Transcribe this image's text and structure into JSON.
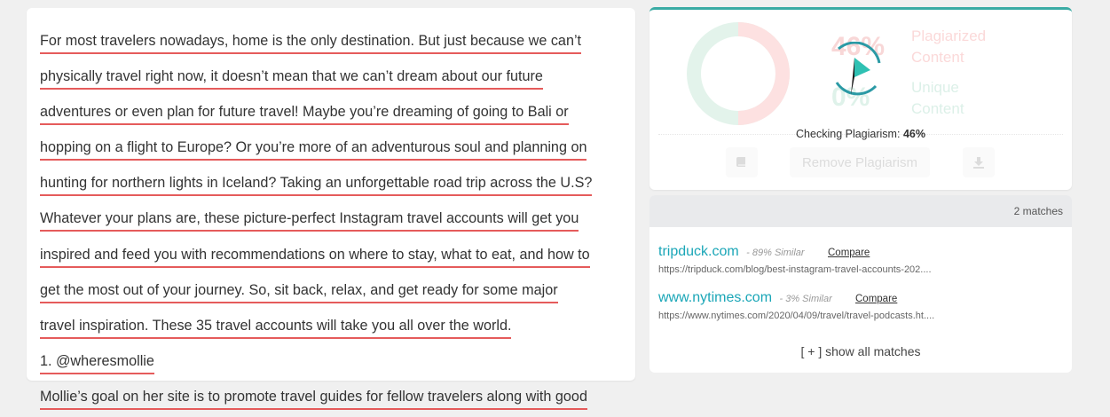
{
  "article": {
    "lines": [
      "For most travelers nowadays, home is the only destination. But just because we can’t",
      "physically travel right now, it doesn’t mean that we can’t dream about our future",
      "adventures or even plan for future travel! Maybe you’re dreaming of going to Bali or",
      "hopping on a flight to Europe? Or you’re more of an adventurous soul and planning on",
      "hunting for northern lights in Iceland? Taking an unforgettable road trip across the U.S?",
      "Whatever your plans are, these picture-perfect Instagram travel accounts will get you",
      "inspired and feed you with recommendations on where to stay, what to eat, and how to",
      "get the most out of your journey.  So, sit back, relax, and get ready for some major",
      "travel inspiration. These 35 travel accounts will take you all over the world.",
      "1. @wheresmollie",
      "Mollie’s goal on her site is to promote travel guides for fellow travelers along with good"
    ]
  },
  "result": {
    "plagiarized_pct": "46%",
    "unique_pct": "0%",
    "plagiarized_label_1": "Plagiarized",
    "plagiarized_label_2": "Content",
    "unique_label_1": "Unique",
    "unique_label_2": "Content",
    "checking_label": "Checking Plagiarism:",
    "checking_value": "46%",
    "remove_button": "Remove Plagiarism",
    "colors": {
      "plagiarized": "#fde0e0",
      "unique": "#e2f2ea",
      "accent": "#3aaba4"
    }
  },
  "matches": {
    "count_label": "2 matches",
    "items": [
      {
        "site": "tripduck.com",
        "similarity": "- 89% Similar",
        "compare": "Compare",
        "url": "https://tripduck.com/blog/best-instagram-travel-accounts-202...."
      },
      {
        "site": "www.nytimes.com",
        "similarity": "- 3% Similar",
        "compare": "Compare",
        "url": "https://www.nytimes.com/2020/04/09/travel/travel-podcasts.ht...."
      }
    ],
    "show_all": "[ + ] show all matches"
  }
}
